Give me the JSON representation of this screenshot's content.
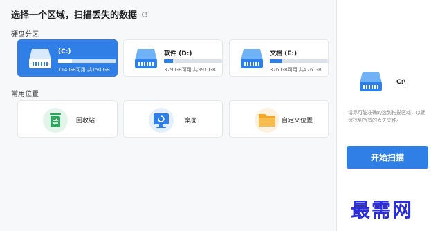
{
  "header": {
    "title": "选择一个区域，扫描丢失的数据"
  },
  "sections": {
    "partitions": "硬盘分区",
    "common": "常用位置"
  },
  "drives": [
    {
      "name": "(C:)",
      "size": "114 GB可用 共150 GB",
      "used": 0.24,
      "selected": true
    },
    {
      "name": "软件 (D:)",
      "size": "329 GB可用 共391 GB",
      "used": 0.16,
      "selected": false
    },
    {
      "name": "文档 (E:)",
      "size": "376 GB可用 共476 GB",
      "used": 0.21,
      "selected": false
    }
  ],
  "locations": [
    {
      "label": "回收站",
      "icon": "recycle-bin-icon"
    },
    {
      "label": "桌面",
      "icon": "desktop-icon"
    },
    {
      "label": "自定义位置",
      "icon": "folder-icon"
    }
  ],
  "panel": {
    "selected_drive": "C:\\",
    "hint": "请尽可能准确的选到扫描区域，以确保找到所有的丢失文件。",
    "start_label": "开始扫描"
  },
  "watermark": "最需网",
  "colors": {
    "accent": "#2f7fe6",
    "watermark": "#2a2de0"
  }
}
